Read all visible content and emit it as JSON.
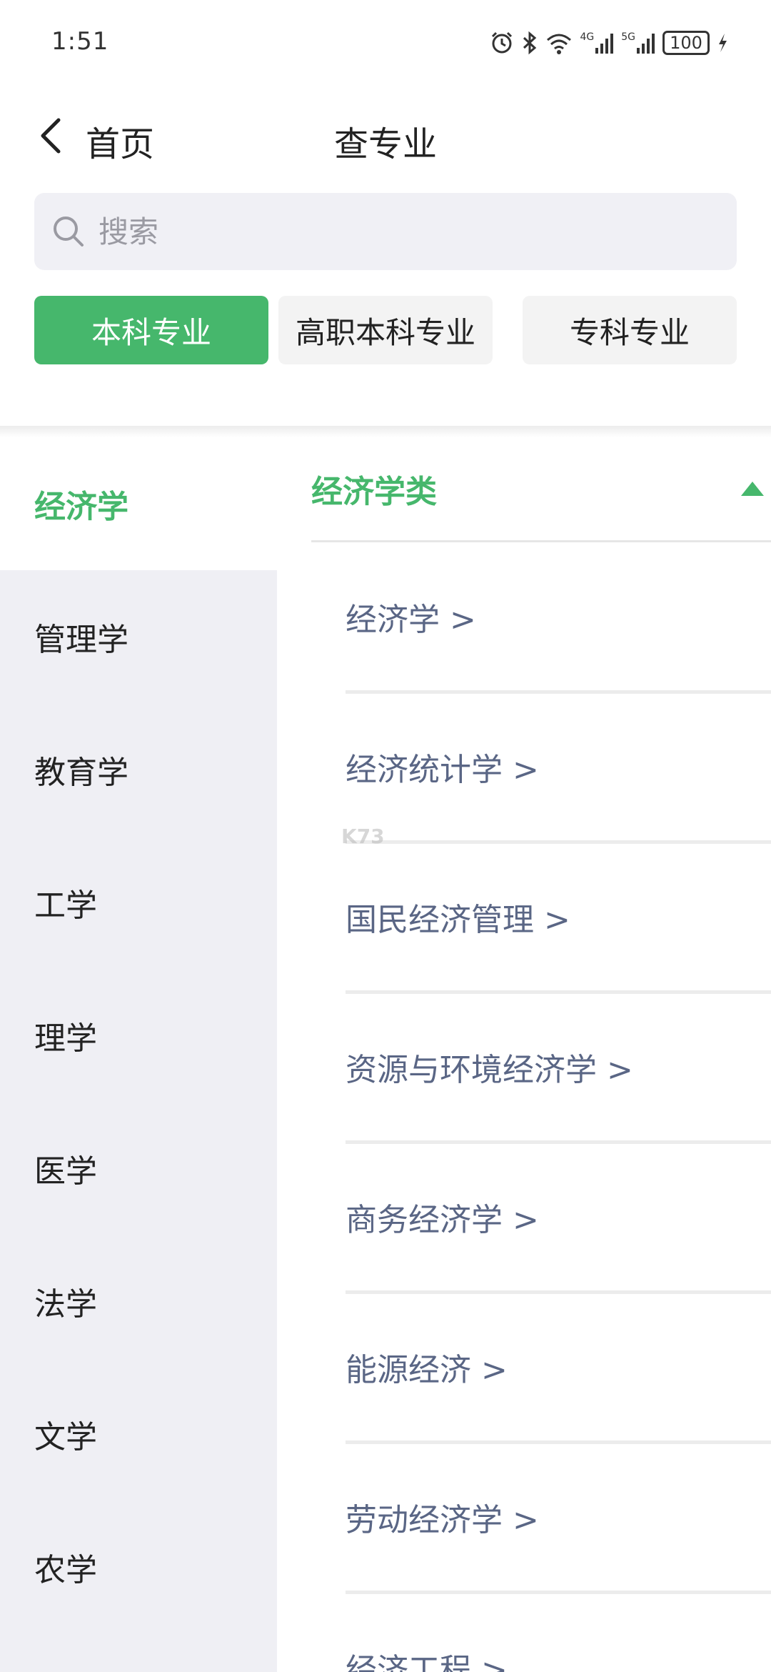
{
  "status_bar": {
    "time": "1:51",
    "network_1": "4G",
    "network_2": "5G",
    "battery": "100"
  },
  "nav": {
    "back_label": "首页",
    "title": "查专业"
  },
  "search": {
    "placeholder": "搜索"
  },
  "tabs": [
    {
      "label": "本科专业",
      "active": true
    },
    {
      "label": "高职本科专业",
      "active": false
    },
    {
      "label": "专科专业",
      "active": false
    }
  ],
  "sidebar": {
    "items": [
      {
        "label": "经济学",
        "active": true
      },
      {
        "label": "管理学"
      },
      {
        "label": "教育学"
      },
      {
        "label": "工学"
      },
      {
        "label": "理学"
      },
      {
        "label": "医学"
      },
      {
        "label": "法学"
      },
      {
        "label": "文学"
      },
      {
        "label": "农学"
      }
    ]
  },
  "main": {
    "group_title": "经济学类",
    "majors": [
      "经济学 >",
      "经济统计学 >",
      "国民经济管理 >",
      "资源与环境经济学 >",
      "商务经济学 >",
      "能源经济 >",
      "劳动经济学 >",
      "经济工程 >"
    ]
  },
  "watermark": {
    "text": "K73"
  },
  "colors": {
    "accent": "#46b76c",
    "sidebar_bg": "#efeff4",
    "major_text": "#5a6685"
  }
}
